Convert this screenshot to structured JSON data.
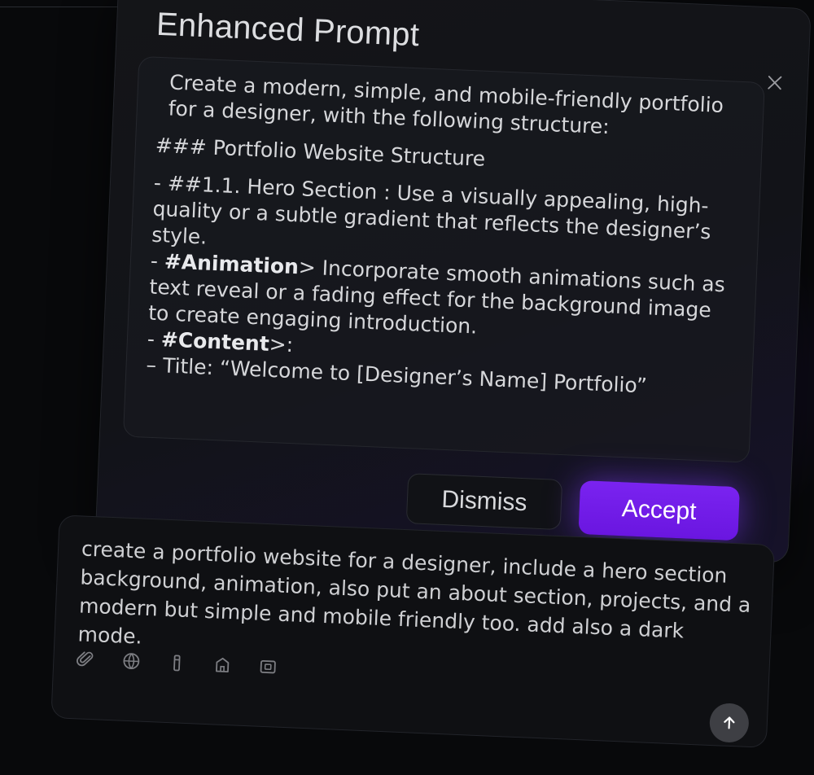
{
  "modal": {
    "title": "Enhanced Prompt",
    "prompt_lines": {
      "intro": "Create a modern, simple, and mobile-friendly portfolio for a designer, with the following structure:",
      "heading": "### Portfolio Website Structure",
      "hero_prefix": "- ##1.1. Hero Section : Use a visually appealing, high-quality or a subtle gradient that reflects the designer’s style.",
      "animation_dash": "- ",
      "animation_bold": "#Animation",
      "animation_text": "> Incorporate smooth animations such as text reveal or a fading effect for the background image to create engaging introduction.",
      "content_dash": "- ",
      "content_bold": "#Content",
      "content_text": ">:",
      "title_line": "– Title: “Welcome to [Designer’s Name] Portfolio”"
    },
    "dismiss_label": "Dismiss",
    "accept_label": "Accept"
  },
  "input": {
    "text": "create a portfolio website for a designer, include a hero section background, animation, also put an about section, projects, and a modern but simple and mobile friendly too. add also a dark mode."
  },
  "icons": {
    "close": "close-icon",
    "attach": "paperclip-icon",
    "web": "globe-icon",
    "tool": "marker-icon",
    "figma": "figma-import-icon",
    "screenshot": "frame-icon",
    "send": "arrow-up-icon"
  },
  "colors": {
    "accent": "#6f1ce8",
    "background": "#08090b"
  }
}
